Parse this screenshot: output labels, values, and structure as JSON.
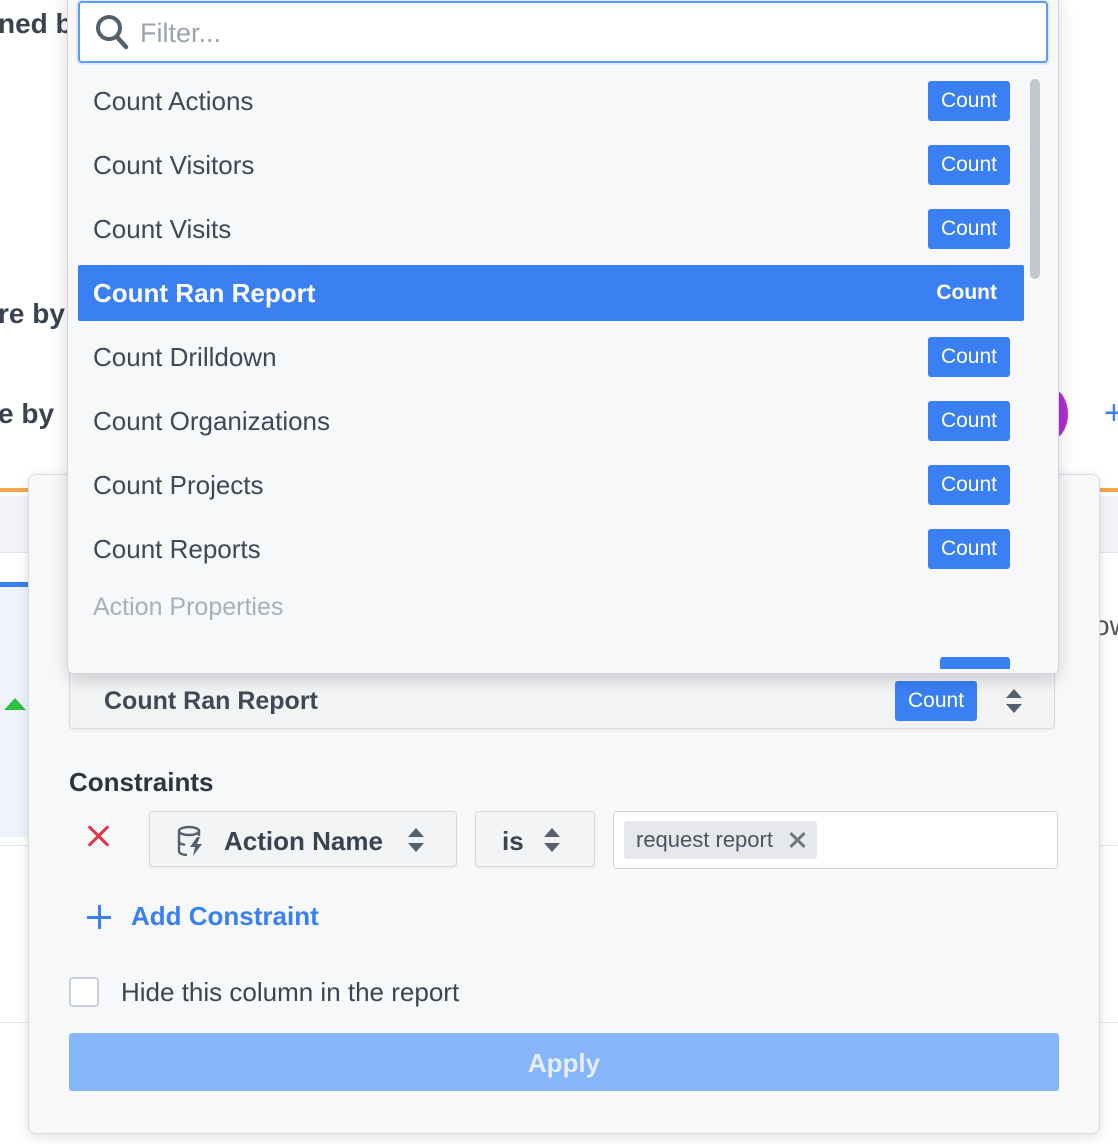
{
  "background": {
    "fragments": [
      "ned b",
      "re by",
      "e by",
      "ow"
    ]
  },
  "dropdown": {
    "filter_placeholder": "Filter...",
    "options": [
      {
        "label": "Count Actions",
        "badge": "Count",
        "selected": false
      },
      {
        "label": "Count Visitors",
        "badge": "Count",
        "selected": false
      },
      {
        "label": "Count Visits",
        "badge": "Count",
        "selected": false
      },
      {
        "label": "Count Ran Report",
        "badge": "Count",
        "selected": true
      },
      {
        "label": "Count Drilldown",
        "badge": "Count",
        "selected": false
      },
      {
        "label": "Count Organizations",
        "badge": "Count",
        "selected": false
      },
      {
        "label": "Count Projects",
        "badge": "Count",
        "selected": false
      },
      {
        "label": "Count Reports",
        "badge": "Count",
        "selected": false
      }
    ],
    "group_header": "Action Properties"
  },
  "panel": {
    "selected_measure": {
      "label": "Count Ran Report",
      "badge": "Count"
    },
    "constraints_heading": "Constraints",
    "constraint": {
      "field": "Action Name",
      "operator": "is",
      "values": [
        "request report"
      ]
    },
    "add_constraint_label": "Add Constraint",
    "hide_column_label": "Hide this column in the report",
    "hide_column_checked": false,
    "apply_label": "Apply"
  },
  "colors": {
    "accent": "#3a80f3",
    "remove": "#e33543",
    "apply_disabled": "#86b6f7"
  }
}
